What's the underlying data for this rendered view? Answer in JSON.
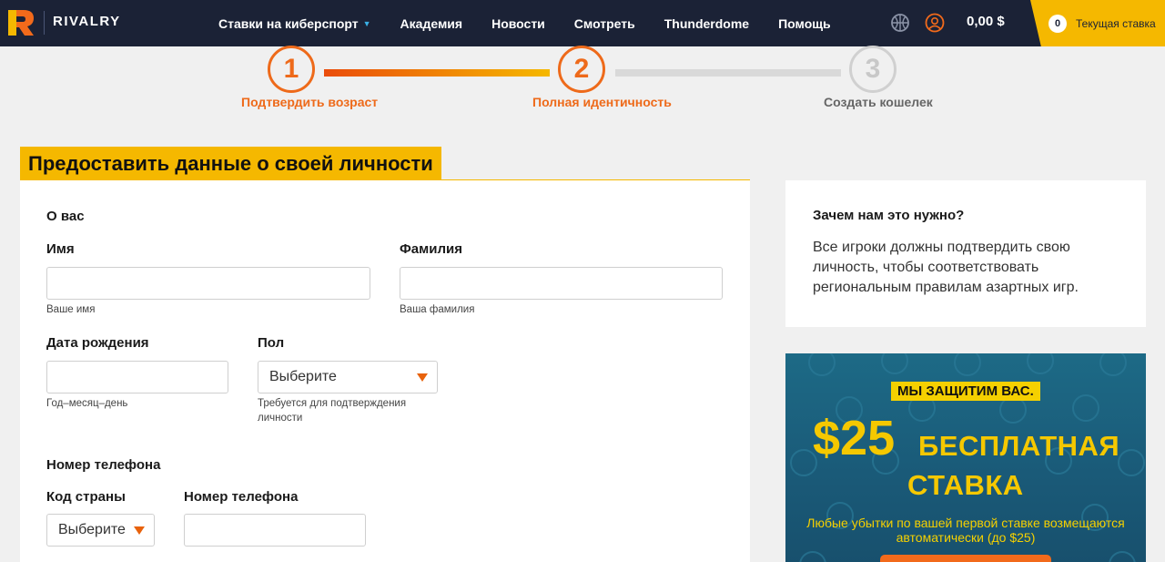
{
  "nav": {
    "brand": "RIVALRY",
    "links": [
      {
        "label": "Ставки на киберспорт",
        "dropdown": true
      },
      {
        "label": "Академия"
      },
      {
        "label": "Новости"
      },
      {
        "label": "Смотреть"
      },
      {
        "label": "Thunderdome"
      },
      {
        "label": "Помощь"
      }
    ],
    "balance": "0,00 $",
    "bet_slip": {
      "count": "0",
      "label": "Текущая ставка"
    },
    "icons": [
      "logo-icon",
      "basketball-icon",
      "user-icon",
      "caret-down-icon"
    ]
  },
  "stepper": {
    "steps": [
      {
        "number": "1",
        "label": "Подтвердить возраст",
        "state": "done"
      },
      {
        "number": "2",
        "label": "Полная идентичность",
        "state": "active"
      },
      {
        "number": "3",
        "label": "Создать кошелек",
        "state": "pending"
      }
    ]
  },
  "form": {
    "title": "Предоставить данные о своей личности",
    "about_heading": "О вас",
    "first_name": {
      "label": "Имя",
      "value": "",
      "help": "Ваше имя"
    },
    "last_name": {
      "label": "Фамилия",
      "value": "",
      "help": "Ваша фамилия"
    },
    "dob": {
      "label": "Дата рождения",
      "value": "",
      "help": "Год–месяц–день"
    },
    "gender": {
      "label": "Пол",
      "value": "Выберите",
      "help": "Требуется для подтверждения личности"
    },
    "phone_heading": "Номер телефона",
    "country_code": {
      "label": "Код страны",
      "value": "Выберите"
    },
    "phone_number": {
      "label": "Номер телефона",
      "value": ""
    }
  },
  "why": {
    "title": "Зачем нам это нужно?",
    "text": "Все игроки должны подтвердить свою личность, чтобы соответствовать региональным правилам азартных игр."
  },
  "promo": {
    "tag": "МЫ ЗАЩИТИМ ВАС.",
    "amount": "$25",
    "free_line1": "БЕСПЛАТНАЯ",
    "free_line2": "СТАВКА",
    "small": "Любые убытки по вашей первой ставке возмещаются автоматически (до $25)"
  },
  "colors": {
    "nav_bg": "#1b2236",
    "accent_yellow": "#f5b800",
    "accent_orange": "#e8620c",
    "promo_bg": "#1d6a86"
  }
}
